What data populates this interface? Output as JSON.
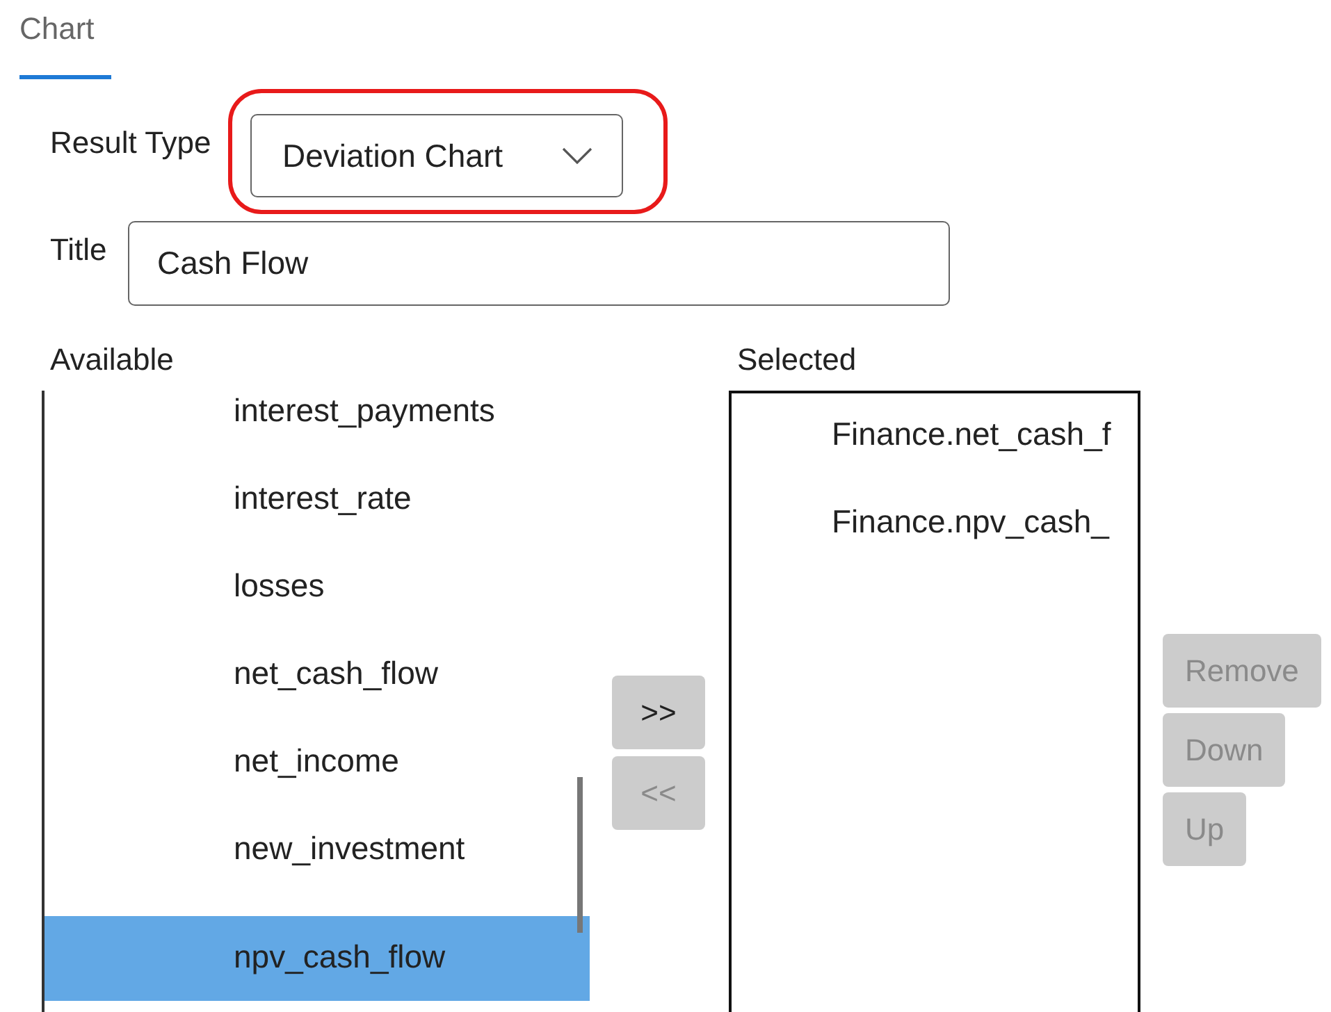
{
  "tabs": [
    {
      "label": "Chart",
      "selected": true
    }
  ],
  "result_type": {
    "label": "Result Type",
    "value": "Deviation Chart",
    "highlighted": true
  },
  "title_field": {
    "label": "Title",
    "value": "Cash Flow"
  },
  "available": {
    "label": "Available",
    "items": [
      {
        "label": "interest_payments",
        "selected": false
      },
      {
        "label": "interest_rate",
        "selected": false
      },
      {
        "label": "losses",
        "selected": false
      },
      {
        "label": "net_cash_flow",
        "selected": false
      },
      {
        "label": "net_income",
        "selected": false
      },
      {
        "label": "new_investment",
        "selected": false
      },
      {
        "label": "npv_cash_flow",
        "selected": true
      }
    ]
  },
  "transfer_buttons": [
    {
      "label": ">>",
      "disabled": false
    },
    {
      "label": "<<",
      "disabled": true
    }
  ],
  "selected": {
    "label": "Selected",
    "items": [
      "Finance.net_cash_f",
      "Finance.npv_cash_"
    ]
  },
  "order_buttons": [
    {
      "label": "Remove",
      "disabled": true
    },
    {
      "label": "Down",
      "disabled": true
    },
    {
      "label": "Up",
      "disabled": true
    }
  ]
}
